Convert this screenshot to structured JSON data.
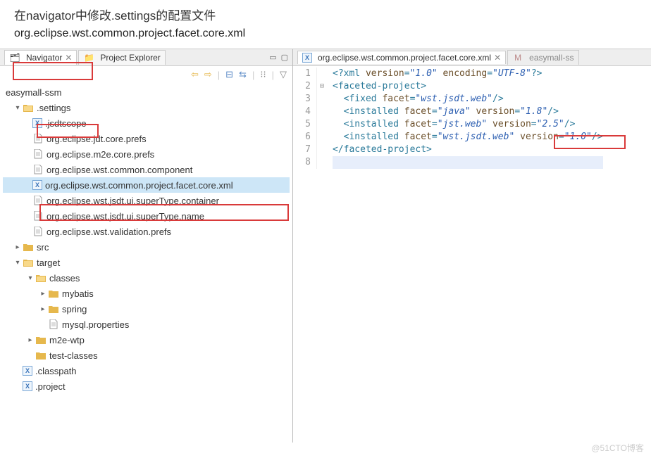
{
  "header": {
    "instruction": "在navigator中修改.settings的配置文件",
    "filename": "org.eclipse.wst.common.project.facet.core.xml"
  },
  "leftPanel": {
    "tabs": {
      "navigator": "Navigator",
      "projectExplorer": "Project Explorer"
    },
    "root": "easymall-ssm",
    "tree": {
      "settings": ".settings",
      "jsdtscope": ".jsdtscope",
      "jdtprefs": "org.eclipse.jdt.core.prefs",
      "m2eprefs": "org.eclipse.m2e.core.prefs",
      "wstcomp": "org.eclipse.wst.common.component",
      "facetcore": "org.eclipse.wst.common.project.facet.core.xml",
      "jsdtcont": "org.eclipse.wst.jsdt.ui.superType.container",
      "jsdtname": "org.eclipse.wst.jsdt.ui.superType.name",
      "wstvalid": "org.eclipse.wst.validation.prefs",
      "src": "src",
      "target": "target",
      "classes": "classes",
      "mybatis": "mybatis",
      "spring": "spring",
      "mysqlprops": "mysql.properties",
      "m2ewtp": "m2e-wtp",
      "testclasses": "test-classes",
      "classpath": ".classpath",
      "project": ".project"
    }
  },
  "rightPanel": {
    "tabs": {
      "active": "org.eclipse.wst.common.project.facet.core.xml",
      "inactive": "easymall-ss"
    },
    "lines": [
      "1",
      "2",
      "3",
      "4",
      "5",
      "6",
      "7",
      "8"
    ],
    "xml": {
      "pi_open": "<?xml",
      "pi_attr1": " version",
      "pi_val1": "\"1.0\"",
      "pi_attr2": " encoding",
      "pi_val2": "\"UTF-8\"",
      "pi_close": "?>",
      "root_open": "<faceted-project>",
      "fixed_open": "  <fixed",
      "facet_attr": " facet",
      "fixed_val": "\"wst.jsdt.web\"",
      "tag_selfclose": "/>",
      "inst_open": "  <installed",
      "java_val": "\"java\"",
      "version_attr": " version",
      "v18": "\"1.8\"",
      "jstweb_val": "\"jst.web\"",
      "v25": "\"2.5\"",
      "jsdtweb_val": "\"wst.jsdt.web\"",
      "v10": "\"1.0\"",
      "root_close": "</faceted-project>"
    }
  },
  "watermark": "@51CTO博客"
}
